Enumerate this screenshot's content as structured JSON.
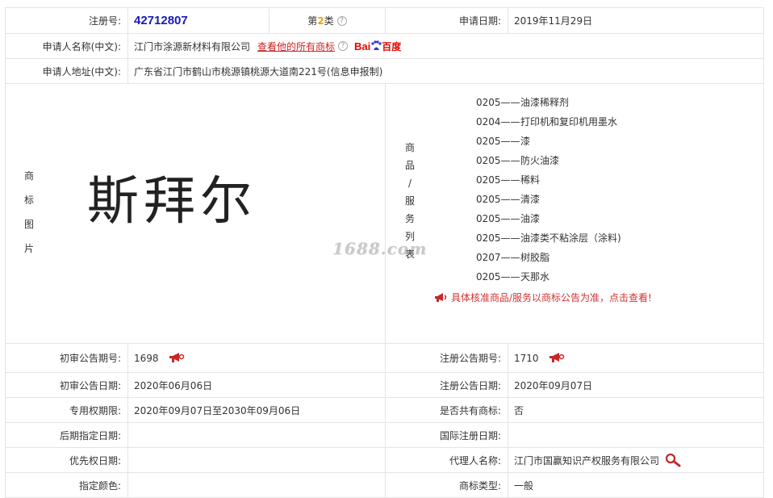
{
  "header": {
    "reg_no_label": "注册号:",
    "reg_no": "42712807",
    "class_prefix": "第",
    "class_num": "2",
    "class_suffix": "类",
    "apply_date_label": "申请日期:",
    "apply_date": "2019年11月29日"
  },
  "applicant": {
    "name_label": "申请人名称(中文):",
    "name": "江门市涂源新材料有限公司",
    "all_marks_link": "查看他的所有商标",
    "baidu_text": "Bai",
    "baidu_cn": "百度",
    "addr_label": "申请人地址(中文):",
    "addr": "广东省江门市鹤山市桃源镇桃源大道南221号(信息申报制)"
  },
  "trademark": {
    "image_label_chars": [
      "商",
      "标",
      "图",
      "片"
    ],
    "mark_text": "斯拜尔",
    "watermark": "1688.com",
    "goods_label_chars": [
      "商",
      "品",
      "/",
      "服",
      "务",
      "列",
      "表"
    ],
    "goods": [
      {
        "code": "0205——",
        "name": "油漆稀释剂"
      },
      {
        "code": "0204——",
        "name": "打印机和复印机用墨水"
      },
      {
        "code": "0205——",
        "name": "漆"
      },
      {
        "code": "0205——",
        "name": "防火油漆"
      },
      {
        "code": "0205——",
        "name": "稀料"
      },
      {
        "code": "0205——",
        "name": "清漆"
      },
      {
        "code": "0205——",
        "name": "油漆"
      },
      {
        "code": "0205——",
        "name": "油漆类不粘涂层（涂料)"
      },
      {
        "code": "0207——",
        "name": "树胶脂"
      },
      {
        "code": "0205——",
        "name": "天那水"
      }
    ],
    "notice": "具体核准商品/服务以商标公告为准，点击查看!"
  },
  "details": {
    "prelim_issue_label": "初审公告期号:",
    "prelim_issue": "1698",
    "reg_issue_label": "注册公告期号:",
    "reg_issue": "1710",
    "prelim_date_label": "初审公告日期:",
    "prelim_date": "2020年06月06日",
    "reg_date_label": "注册公告日期:",
    "reg_date": "2020年09月07日",
    "exclusive_label": "专用权期限:",
    "exclusive": "2020年09月07日至2030年09月06日",
    "shared_label": "是否共有商标:",
    "shared": "否",
    "later_date_label": "后期指定日期:",
    "later_date": "",
    "intl_date_label": "国际注册日期:",
    "intl_date": "",
    "priority_label": "优先权日期:",
    "priority": "",
    "agent_label": "代理人名称:",
    "agent": "江门市国赢知识产权服务有限公司",
    "color_label": "指定颜色:",
    "color": "",
    "type_label": "商标类型:",
    "type": "一般"
  },
  "colors": {
    "reg_no": "#1a1ab8",
    "link_red": "#cc2222",
    "border": "#e4e4e4"
  }
}
